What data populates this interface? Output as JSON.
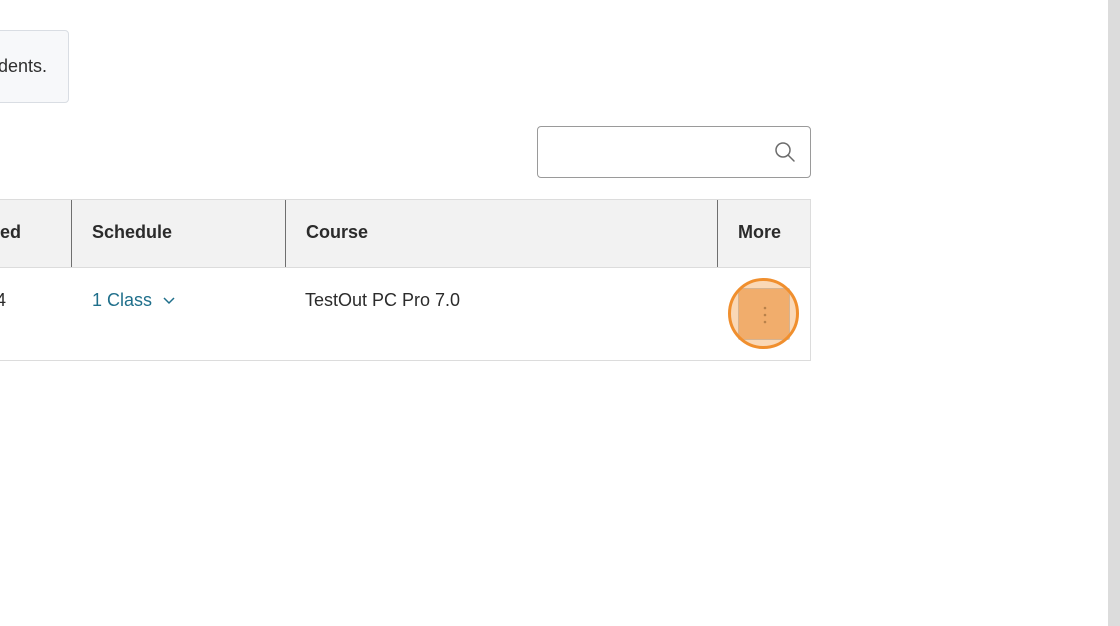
{
  "notice": {
    "text": "dents."
  },
  "search": {
    "placeholder": "",
    "value": "",
    "icon": "search-icon"
  },
  "table": {
    "columns": [
      {
        "label": "ed"
      },
      {
        "label": "Schedule"
      },
      {
        "label": "Course"
      },
      {
        "label": "More"
      }
    ],
    "rows": [
      {
        "col0": "4",
        "schedule": "1 Class",
        "course": "TestOut PC Pro 7.0",
        "more_icon": "vertical-ellipsis-icon"
      }
    ]
  },
  "colors": {
    "link": "#1f6f8b",
    "highlight": "#f08f2e",
    "header_bg": "#f2f2f2"
  }
}
